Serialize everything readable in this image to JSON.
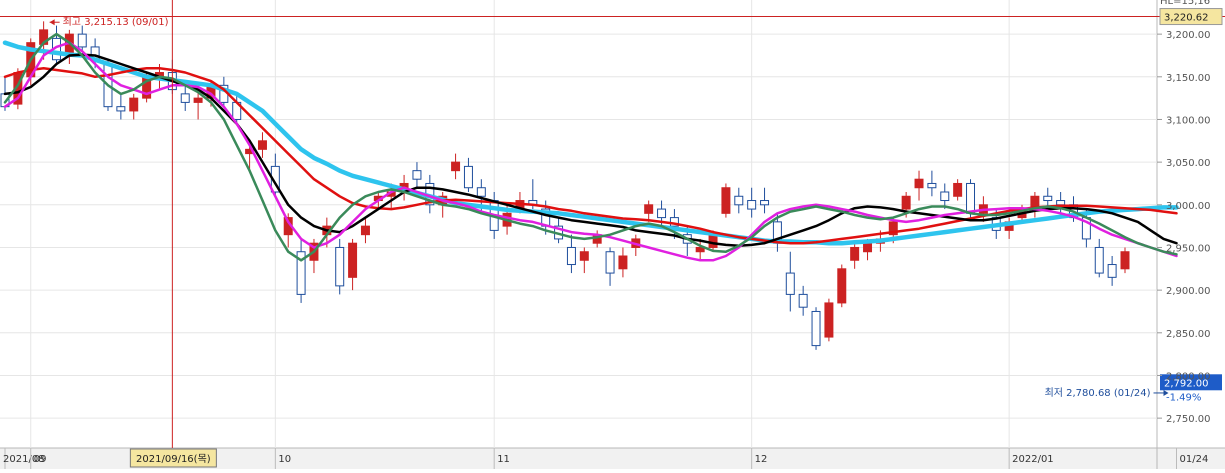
{
  "chart_data": {
    "type": "candlestick",
    "x_labels": [
      {
        "text": "2021/08",
        "i": 0
      },
      {
        "text": "09",
        "i": 2
      },
      {
        "text": "10",
        "i": 21
      },
      {
        "text": "11",
        "i": 38
      },
      {
        "text": "12",
        "i": 58
      },
      {
        "text": "2022/01",
        "i": 78
      },
      {
        "text": "01/24",
        "i": 91
      }
    ],
    "crosshair": {
      "date_label": "2021/09/16(목)",
      "i": 13,
      "value": 3220.62
    },
    "y_ticks": [
      3200,
      3150,
      3100,
      3050,
      3000,
      2950,
      2900,
      2850,
      2800,
      2750
    ],
    "y_tick_labels": [
      "3,200.00",
      "3,150.00",
      "3,100.00",
      "3,050.00",
      "3,000.00",
      "2,950.00",
      "2,900.00",
      "2,850.00",
      "2,800.00",
      "2,750.00"
    ],
    "ylim": [
      2715,
      3240
    ],
    "crosshair_value_label": "3,220.62",
    "current_price": {
      "value": 2792.0,
      "label": "2,792.00",
      "change_label": "-1.49%"
    },
    "max_annotation": {
      "text": "최고 3,215.13 (09/01)",
      "i": 3,
      "value": 3215.13
    },
    "min_annotation": {
      "text": "최저 2,780.68 (01/24)",
      "i": 91,
      "value": 2780.68
    },
    "top_right_label": "HL=15,16",
    "colors": {
      "up": "#cc2222",
      "down": "#1f4e9c",
      "ma5": "#3a8a5a",
      "ma10": "#e020e0",
      "ma20": "#000000",
      "ma60": "#e01010",
      "ma120": "#2ec4ee",
      "crosshair": "#cc2222",
      "price_box": "#1e5cc8",
      "hi_box": "#f5e6a0"
    },
    "candles": [
      [
        3130,
        3150,
        3110,
        3115
      ],
      [
        3118,
        3160,
        3112,
        3155
      ],
      [
        3150,
        3195,
        3140,
        3190
      ],
      [
        3188,
        3215,
        3170,
        3205
      ],
      [
        3195,
        3210,
        3165,
        3170
      ],
      [
        3175,
        3205,
        3165,
        3200
      ],
      [
        3200,
        3210,
        3180,
        3185
      ],
      [
        3185,
        3195,
        3160,
        3170
      ],
      [
        3165,
        3170,
        3110,
        3115
      ],
      [
        3115,
        3130,
        3100,
        3110
      ],
      [
        3110,
        3130,
        3100,
        3125
      ],
      [
        3125,
        3155,
        3120,
        3150
      ],
      [
        3150,
        3165,
        3135,
        3155
      ],
      [
        3155,
        3170,
        3130,
        3135
      ],
      [
        3130,
        3145,
        3110,
        3120
      ],
      [
        3120,
        3135,
        3100,
        3125
      ],
      [
        3125,
        3145,
        3115,
        3140
      ],
      [
        3140,
        3150,
        3115,
        3120
      ],
      [
        3120,
        3130,
        3095,
        3100
      ],
      [
        3060,
        3075,
        3040,
        3065
      ],
      [
        3065,
        3085,
        3055,
        3075
      ],
      [
        3045,
        3060,
        3010,
        3015
      ],
      [
        2965,
        2990,
        2950,
        2985
      ],
      [
        2945,
        2960,
        2885,
        2895
      ],
      [
        2935,
        2960,
        2920,
        2955
      ],
      [
        2965,
        2985,
        2950,
        2975
      ],
      [
        2950,
        2960,
        2895,
        2905
      ],
      [
        2915,
        2960,
        2900,
        2955
      ],
      [
        2965,
        2985,
        2955,
        2975
      ],
      [
        3005,
        3015,
        2995,
        3010
      ],
      [
        3010,
        3025,
        2995,
        3015
      ],
      [
        3015,
        3035,
        3005,
        3025
      ],
      [
        3040,
        3050,
        3020,
        3030
      ],
      [
        3025,
        3035,
        2990,
        3000
      ],
      [
        3000,
        3015,
        2985,
        3010
      ],
      [
        3040,
        3060,
        3030,
        3050
      ],
      [
        3045,
        3055,
        3015,
        3020
      ],
      [
        3020,
        3030,
        2990,
        3010
      ],
      [
        3005,
        3015,
        2960,
        2970
      ],
      [
        2975,
        3000,
        2965,
        2990
      ],
      [
        2995,
        3015,
        2990,
        3005
      ],
      [
        3005,
        3030,
        2995,
        3000
      ],
      [
        2995,
        3005,
        2965,
        2975
      ],
      [
        2975,
        2985,
        2955,
        2960
      ],
      [
        2950,
        2965,
        2920,
        2930
      ],
      [
        2935,
        2950,
        2920,
        2945
      ],
      [
        2955,
        2970,
        2950,
        2965
      ],
      [
        2945,
        2950,
        2905,
        2920
      ],
      [
        2925,
        2950,
        2915,
        2940
      ],
      [
        2950,
        2965,
        2940,
        2960
      ],
      [
        2990,
        3005,
        2980,
        3000
      ],
      [
        2995,
        3005,
        2975,
        2985
      ],
      [
        2985,
        2995,
        2960,
        2975
      ],
      [
        2965,
        2975,
        2940,
        2955
      ],
      [
        2945,
        2960,
        2935,
        2950
      ],
      [
        2950,
        2970,
        2945,
        2965
      ],
      [
        2990,
        3025,
        2985,
        3020
      ],
      [
        3010,
        3020,
        2990,
        3000
      ],
      [
        3005,
        3020,
        2985,
        2995
      ],
      [
        3005,
        3020,
        2990,
        3000
      ],
      [
        2980,
        2990,
        2945,
        2955
      ],
      [
        2920,
        2945,
        2875,
        2895
      ],
      [
        2895,
        2905,
        2870,
        2880
      ],
      [
        2875,
        2880,
        2830,
        2835
      ],
      [
        2845,
        2890,
        2840,
        2885
      ],
      [
        2885,
        2930,
        2880,
        2925
      ],
      [
        2935,
        2955,
        2925,
        2950
      ],
      [
        2945,
        2960,
        2935,
        2955
      ],
      [
        2955,
        2970,
        2945,
        2960
      ],
      [
        2965,
        2985,
        2955,
        2980
      ],
      [
        2995,
        3015,
        2985,
        3010
      ],
      [
        3020,
        3040,
        3005,
        3030
      ],
      [
        3025,
        3040,
        3010,
        3020
      ],
      [
        3015,
        3025,
        2995,
        3005
      ],
      [
        3010,
        3030,
        3005,
        3025
      ],
      [
        3025,
        3030,
        2985,
        2990
      ],
      [
        2990,
        3010,
        2980,
        3000
      ],
      [
        2985,
        2995,
        2960,
        2970
      ],
      [
        2970,
        2985,
        2960,
        2980
      ],
      [
        2985,
        3000,
        2980,
        2995
      ],
      [
        2995,
        3015,
        2985,
        3010
      ],
      [
        3010,
        3020,
        2995,
        3005
      ],
      [
        3005,
        3015,
        2990,
        3000
      ],
      [
        3000,
        3010,
        2980,
        2985
      ],
      [
        2985,
        2995,
        2950,
        2960
      ],
      [
        2950,
        2960,
        2915,
        2920
      ],
      [
        2930,
        2940,
        2905,
        2915
      ],
      [
        2925,
        2950,
        2920,
        2945
      ]
    ],
    "series": [
      {
        "key": "ma120",
        "width": 4.5,
        "values": [
          3190,
          3185,
          3182,
          3180,
          3178,
          3176,
          3175,
          3170,
          3165,
          3160,
          3155,
          3150,
          3148,
          3146,
          3144,
          3142,
          3140,
          3135,
          3130,
          3120,
          3110,
          3095,
          3080,
          3065,
          3055,
          3048,
          3040,
          3034,
          3030,
          3026,
          3022,
          3018,
          3014,
          3010,
          3006,
          3002,
          3000,
          2998,
          2996,
          2994,
          2993,
          2992,
          2991,
          2990,
          2988,
          2986,
          2984,
          2982,
          2980,
          2978,
          2976,
          2974,
          2972,
          2970,
          2968,
          2966,
          2964,
          2962,
          2960,
          2958,
          2957,
          2957,
          2956,
          2956,
          2955,
          2955,
          2956,
          2957,
          2958,
          2960,
          2962,
          2964,
          2966,
          2968,
          2970,
          2972,
          2974,
          2976,
          2978,
          2980,
          2982,
          2984,
          2986,
          2988,
          2990,
          2992,
          2993,
          2994,
          2995,
          2996,
          2997,
          2997
        ]
      },
      {
        "key": "ma60",
        "width": 2.5,
        "values": [
          3150,
          3155,
          3158,
          3160,
          3158,
          3156,
          3154,
          3150,
          3152,
          3155,
          3158,
          3160,
          3160,
          3158,
          3155,
          3150,
          3145,
          3135,
          3120,
          3105,
          3090,
          3075,
          3060,
          3045,
          3030,
          3020,
          3010,
          3002,
          2998,
          2996,
          2995,
          2997,
          3000,
          3003,
          3005,
          3006,
          3005,
          3004,
          3003,
          3002,
          3001,
          3000,
          2998,
          2995,
          2993,
          2990,
          2988,
          2986,
          2984,
          2983,
          2982,
          2980,
          2978,
          2975,
          2972,
          2968,
          2965,
          2962,
          2960,
          2958,
          2956,
          2955,
          2955,
          2956,
          2958,
          2960,
          2962,
          2964,
          2966,
          2968,
          2970,
          2972,
          2975,
          2978,
          2981,
          2984,
          2987,
          2990,
          2993,
          2995,
          2997,
          2998,
          2999,
          2999,
          2999,
          2998,
          2997,
          2996,
          2995,
          2994,
          2992,
          2990
        ]
      },
      {
        "key": "ma20",
        "width": 2.5,
        "values": [
          3130,
          3132,
          3138,
          3150,
          3165,
          3175,
          3176,
          3175,
          3170,
          3165,
          3160,
          3155,
          3150,
          3145,
          3140,
          3135,
          3125,
          3110,
          3095,
          3075,
          3050,
          3025,
          3000,
          2985,
          2975,
          2970,
          2968,
          2975,
          2985,
          2995,
          3005,
          3015,
          3020,
          3020,
          3018,
          3015,
          3012,
          3008,
          3004,
          3000,
          2996,
          2992,
          2988,
          2985,
          2982,
          2980,
          2978,
          2976,
          2974,
          2970,
          2968,
          2966,
          2964,
          2960,
          2958,
          2955,
          2953,
          2952,
          2953,
          2955,
          2960,
          2965,
          2970,
          2975,
          2982,
          2990,
          2996,
          2998,
          2997,
          2995,
          2992,
          2990,
          2988,
          2986,
          2984,
          2982,
          2982,
          2984,
          2987,
          2990,
          2993,
          2995,
          2996,
          2996,
          2995,
          2993,
          2990,
          2985,
          2980,
          2970,
          2960,
          2955
        ]
      },
      {
        "key": "ma10",
        "width": 2.5,
        "values": [
          3115,
          3125,
          3150,
          3175,
          3185,
          3190,
          3180,
          3165,
          3150,
          3140,
          3135,
          3130,
          3135,
          3140,
          3140,
          3138,
          3130,
          3115,
          3095,
          3070,
          3040,
          3010,
          2980,
          2960,
          2950,
          2955,
          2965,
          2980,
          2995,
          3005,
          3015,
          3020,
          3015,
          3010,
          3005,
          3002,
          2998,
          2992,
          2988,
          2985,
          2982,
          2980,
          2976,
          2972,
          2968,
          2966,
          2965,
          2962,
          2958,
          2954,
          2950,
          2946,
          2942,
          2938,
          2935,
          2935,
          2940,
          2950,
          2965,
          2980,
          2990,
          2995,
          2998,
          3000,
          2998,
          2995,
          2992,
          2988,
          2985,
          2982,
          2980,
          2982,
          2985,
          2988,
          2990,
          2992,
          2994,
          2995,
          2996,
          2996,
          2995,
          2993,
          2990,
          2986,
          2980,
          2972,
          2965,
          2960,
          2955,
          2950,
          2945,
          2940
        ]
      },
      {
        "key": "ma5",
        "width": 2.5,
        "values": [
          3120,
          3140,
          3170,
          3190,
          3200,
          3190,
          3175,
          3155,
          3140,
          3130,
          3135,
          3145,
          3150,
          3148,
          3140,
          3132,
          3120,
          3100,
          3070,
          3040,
          3005,
          2970,
          2945,
          2935,
          2945,
          2965,
          2985,
          3000,
          3010,
          3015,
          3018,
          3015,
          3010,
          3005,
          3000,
          2998,
          2995,
          2990,
          2986,
          2982,
          2978,
          2975,
          2970,
          2966,
          2962,
          2960,
          2962,
          2965,
          2970,
          2975,
          2978,
          2975,
          2968,
          2960,
          2952,
          2946,
          2945,
          2952,
          2962,
          2975,
          2985,
          2992,
          2995,
          2998,
          2995,
          2992,
          2988,
          2985,
          2983,
          2985,
          2990,
          2995,
          2998,
          2998,
          2995,
          2990,
          2988,
          2988,
          2990,
          2993,
          2996,
          2998,
          2996,
          2992,
          2985,
          2978,
          2970,
          2962,
          2955,
          2950,
          2945,
          2942
        ]
      }
    ]
  }
}
